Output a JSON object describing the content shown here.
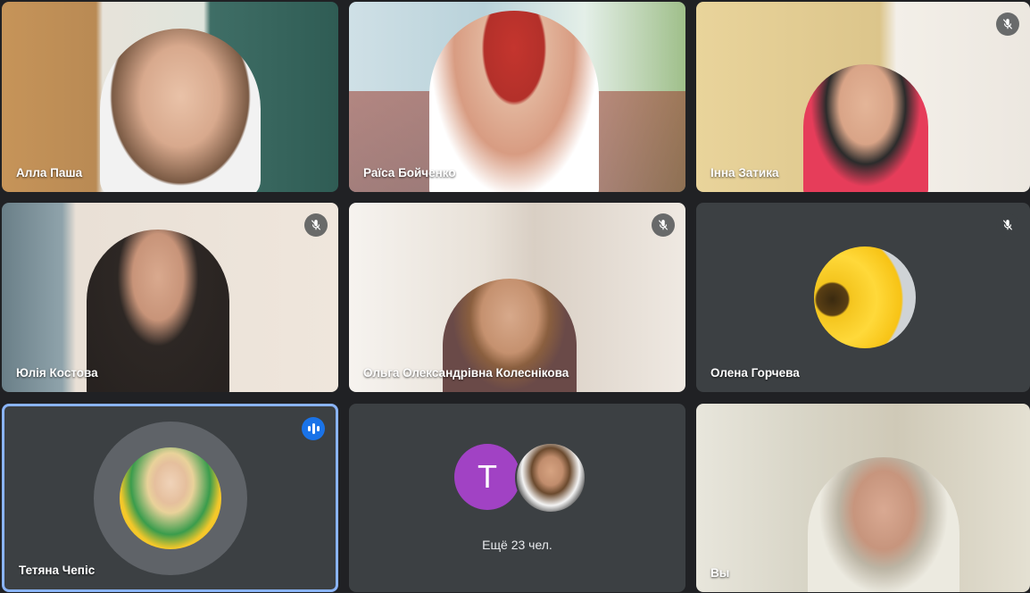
{
  "colors": {
    "background": "#202124",
    "tile_dark": "#3c4043",
    "active_border": "#8ab4f8",
    "speaking_badge": "#1a73e8",
    "avatar_purple": "#a142c4"
  },
  "participants": [
    {
      "name": "Алла Паша",
      "muted": false
    },
    {
      "name": "Раїса Бойченко",
      "muted": false
    },
    {
      "name": "Інна Затика",
      "muted": true
    },
    {
      "name": "Юлія Костова",
      "muted": true
    },
    {
      "name": "Ольга Олександрівна Колеснікова",
      "muted": true
    },
    {
      "name": "Олена Горчева",
      "muted": true
    },
    {
      "name": "Тетяна Чепіс",
      "muted": false,
      "speaking": true
    },
    {
      "name": "Вы",
      "muted": false
    }
  ],
  "others": {
    "avatar_letter": "T",
    "label": "Ещё 23 чел."
  },
  "icons": {
    "mic_off": "mic-off-icon",
    "speaking": "audio-level-icon"
  }
}
